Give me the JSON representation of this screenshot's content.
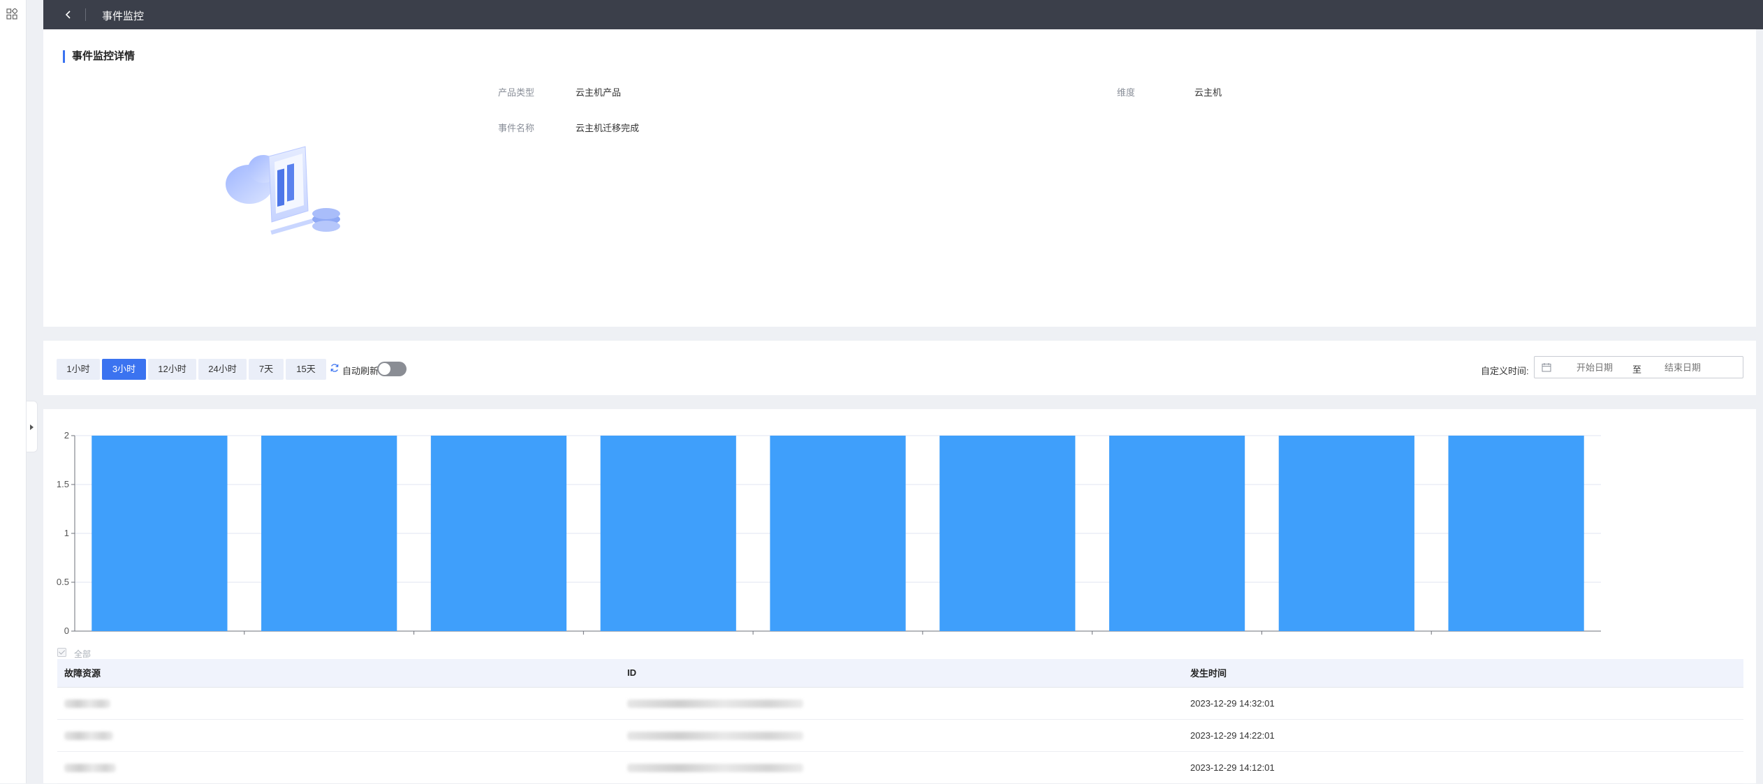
{
  "header": {
    "title": "事件监控"
  },
  "detail": {
    "section_title": "事件监控详情",
    "fields": [
      {
        "label": "产品类型",
        "value": "云主机产品"
      },
      {
        "label": "维度",
        "value": "云主机"
      },
      {
        "label": "事件名称",
        "value": "云主机迁移完成"
      }
    ]
  },
  "toolbar": {
    "ranges": [
      "1小时",
      "3小时",
      "12小时",
      "24小时",
      "7天",
      "15天"
    ],
    "active_range": "3小时",
    "auto_refresh_label": "自动刷新",
    "auto_refresh_on": false,
    "custom_time_label": "自定义时间:",
    "start_placeholder": "开始日期",
    "range_separator": "至",
    "end_placeholder": "结束日期"
  },
  "chart_data": {
    "type": "bar",
    "values": [
      2,
      2,
      2,
      2,
      2,
      2,
      2,
      2,
      2
    ],
    "ylim": [
      0,
      2
    ],
    "yticks": [
      "0",
      "0.5",
      "1",
      "1.5",
      "2"
    ],
    "bar_color": "#3f9ffb",
    "grid": true
  },
  "legend": {
    "label": "全部"
  },
  "table": {
    "columns": [
      "故障资源",
      "ID",
      "发生时间"
    ],
    "rows": [
      {
        "resource": "",
        "id": "",
        "time": "2023-12-29 14:32:01"
      },
      {
        "resource": "",
        "id": "",
        "time": "2023-12-29 14:22:01"
      },
      {
        "resource": "",
        "id": "",
        "time": "2023-12-29 14:12:01"
      }
    ]
  },
  "colors": {
    "accent": "#3b73f0",
    "header_bg": "#3b3f4a",
    "bar": "#3f9ffb"
  }
}
